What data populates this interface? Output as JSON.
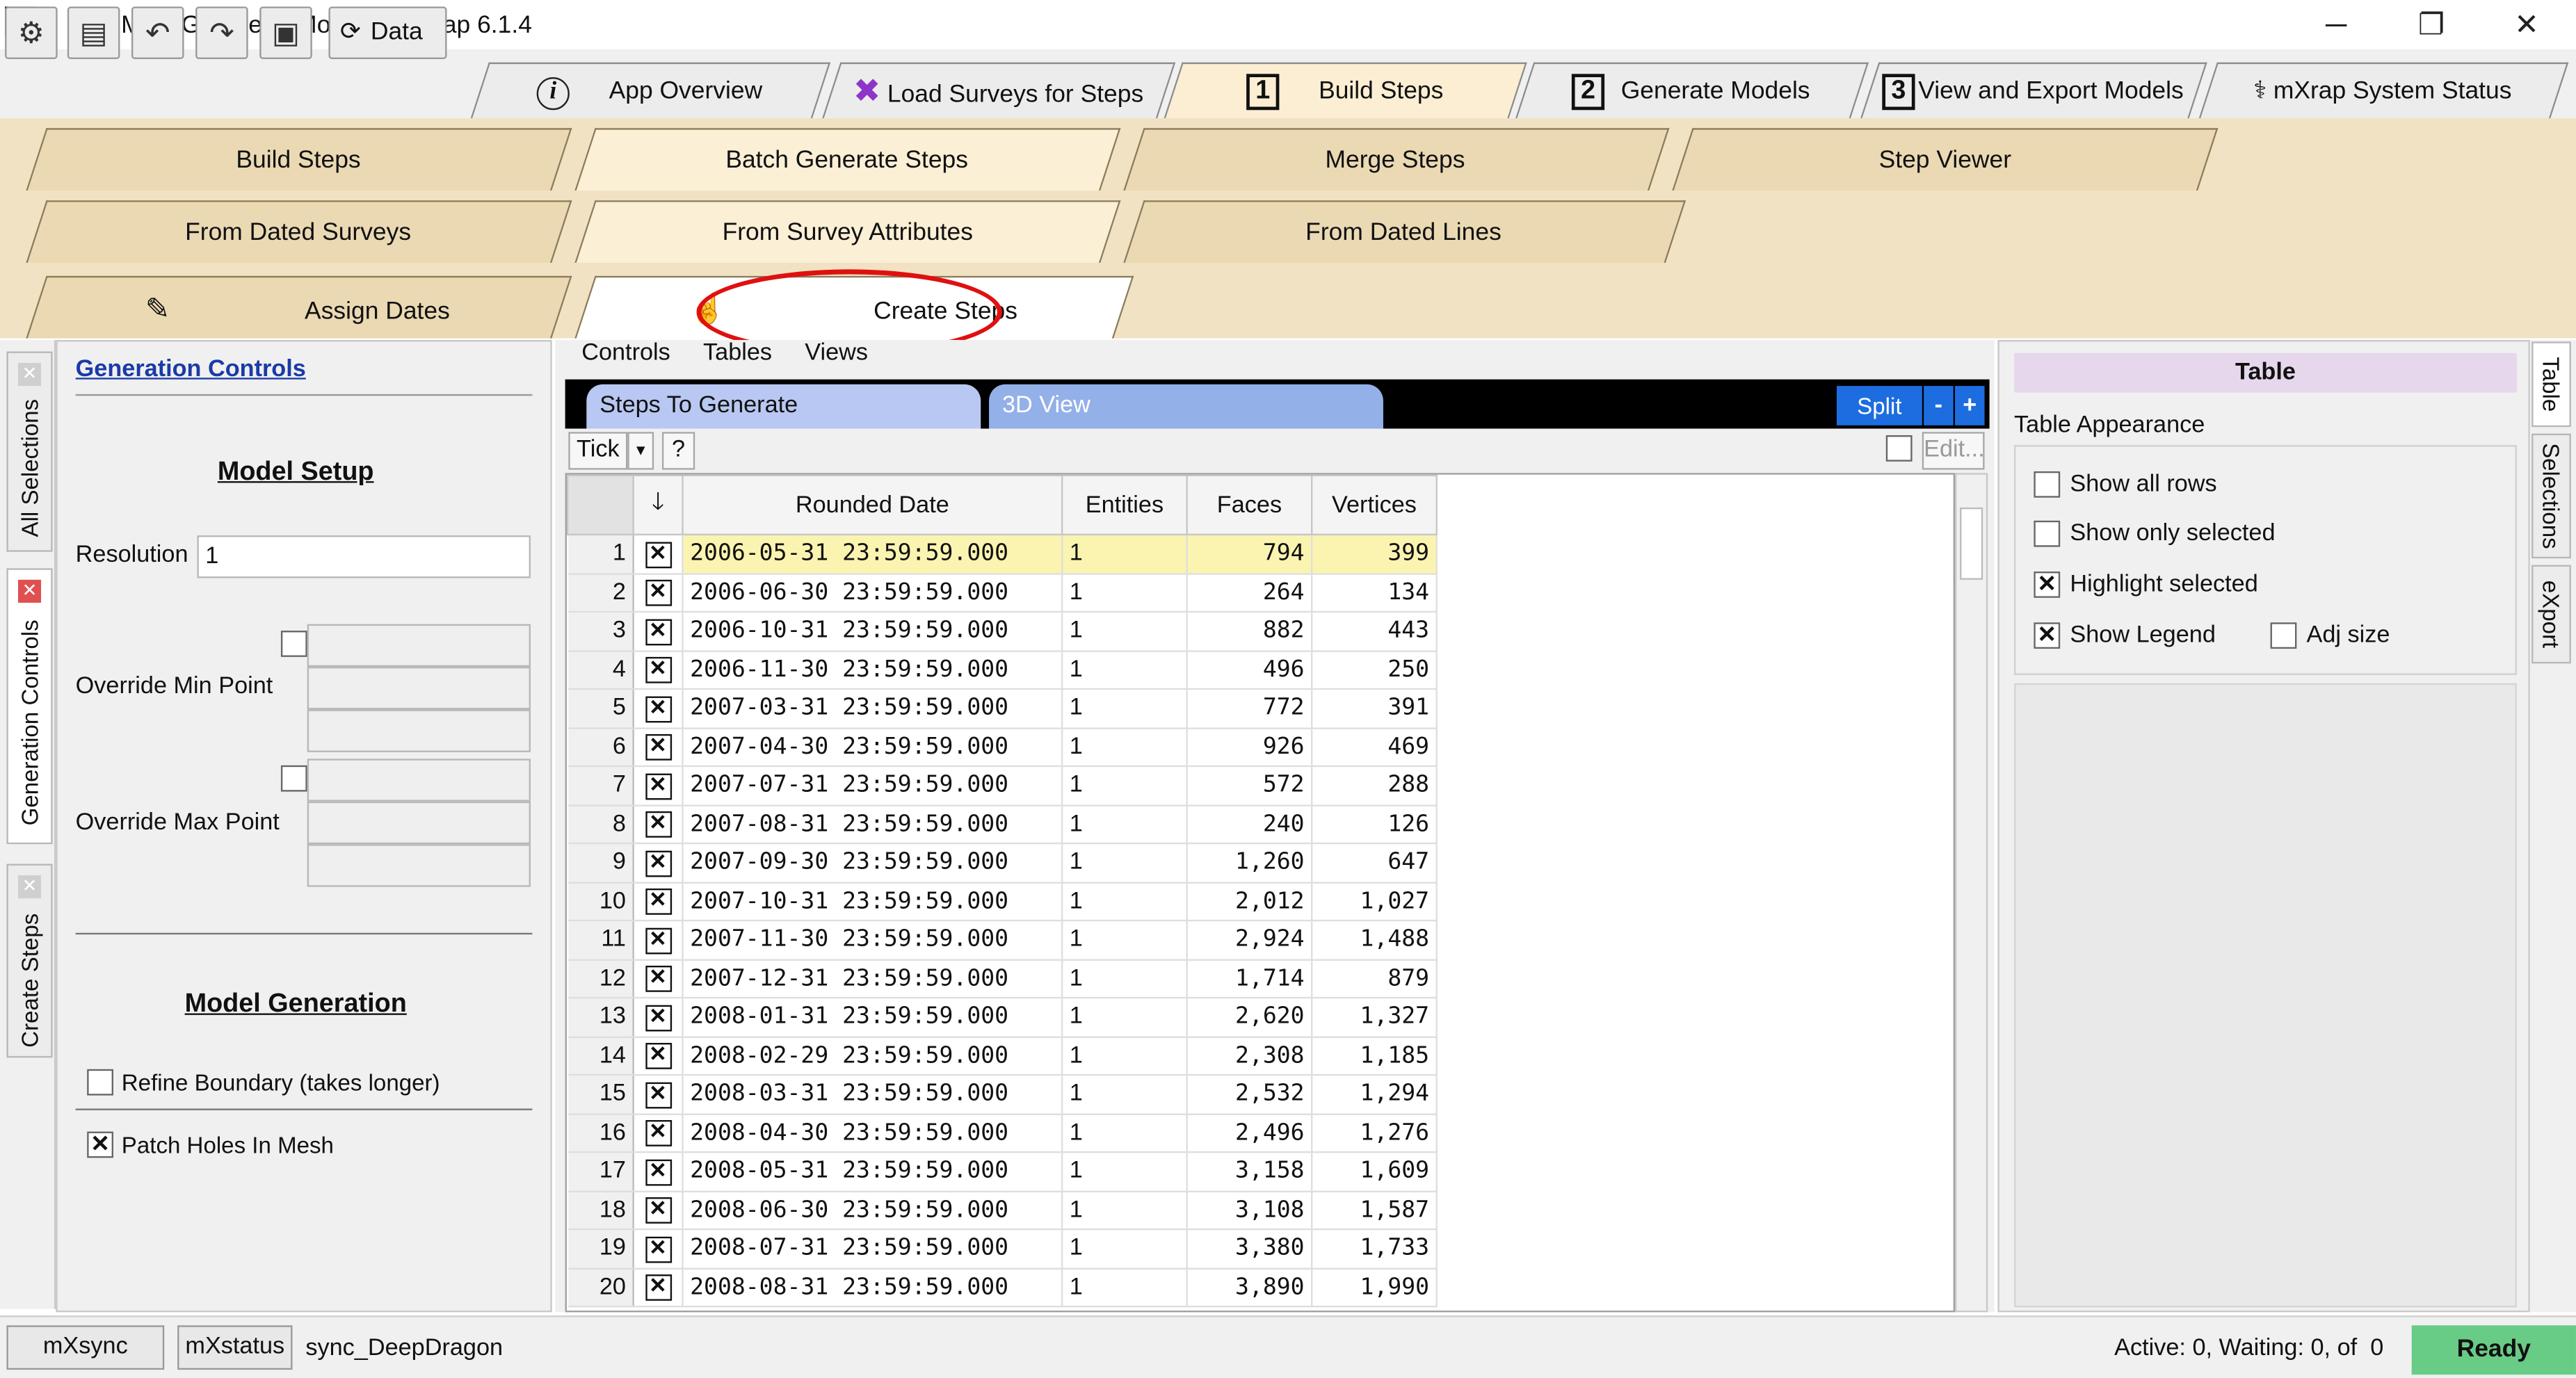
{
  "window": {
    "title": "Mine Geometry Models - mXrap 6.1.4",
    "title_arrow": "▶"
  },
  "toolbar": {
    "data_label": "Data"
  },
  "main_tabs": [
    {
      "label": "App Overview",
      "number": ""
    },
    {
      "label": "Load Surveys for Steps",
      "number": ""
    },
    {
      "label": "Build Steps",
      "number": "1"
    },
    {
      "label": "Generate Models",
      "number": "2"
    },
    {
      "label": "View and Export Models",
      "number": "3"
    },
    {
      "label": "mXrap System Status",
      "number": ""
    }
  ],
  "sub_tabs": [
    "Build Steps",
    "Batch Generate Steps",
    "Merge Steps",
    "Step Viewer"
  ],
  "sub_sub_tabs": [
    "From Dated Surveys",
    "From Survey Attributes",
    "From Dated Lines"
  ],
  "page_tabs": [
    "Assign Dates",
    "Create Steps"
  ],
  "left_vtabs": [
    "All Selections",
    "Generation Controls",
    "Create Steps"
  ],
  "left_panel": {
    "link_header": "Generation Controls",
    "model_setup": "Model Setup",
    "resolution_label": "Resolution",
    "resolution_value": "1",
    "override_min_label": "Override Min Point",
    "override_max_label": "Override Max Point",
    "model_generation": "Model Generation",
    "refine_label": "Refine Boundary (takes longer)",
    "refine_checked": false,
    "patch_label": "Patch Holes In Mesh",
    "patch_checked": true
  },
  "center": {
    "menu": [
      "Controls",
      "Tables",
      "Views"
    ],
    "panel_tabs": [
      "Steps To Generate",
      "3D View"
    ],
    "split_label": "Split",
    "minus_label": "-",
    "plus_label": "+",
    "tick_label": "Tick",
    "help_label": "?",
    "edit_label": "Edit...",
    "columns": [
      "Rounded Date",
      "Entities",
      "Faces",
      "Vertices"
    ],
    "rows": [
      {
        "n": "1",
        "date": "2006-05-31 23:59:59.000",
        "entities": "1",
        "faces": "794",
        "vertices": "399"
      },
      {
        "n": "2",
        "date": "2006-06-30 23:59:59.000",
        "entities": "1",
        "faces": "264",
        "vertices": "134"
      },
      {
        "n": "3",
        "date": "2006-10-31 23:59:59.000",
        "entities": "1",
        "faces": "882",
        "vertices": "443"
      },
      {
        "n": "4",
        "date": "2006-11-30 23:59:59.000",
        "entities": "1",
        "faces": "496",
        "vertices": "250"
      },
      {
        "n": "5",
        "date": "2007-03-31 23:59:59.000",
        "entities": "1",
        "faces": "772",
        "vertices": "391"
      },
      {
        "n": "6",
        "date": "2007-04-30 23:59:59.000",
        "entities": "1",
        "faces": "926",
        "vertices": "469"
      },
      {
        "n": "7",
        "date": "2007-07-31 23:59:59.000",
        "entities": "1",
        "faces": "572",
        "vertices": "288"
      },
      {
        "n": "8",
        "date": "2007-08-31 23:59:59.000",
        "entities": "1",
        "faces": "240",
        "vertices": "126"
      },
      {
        "n": "9",
        "date": "2007-09-30 23:59:59.000",
        "entities": "1",
        "faces": "1,260",
        "vertices": "647"
      },
      {
        "n": "10",
        "date": "2007-10-31 23:59:59.000",
        "entities": "1",
        "faces": "2,012",
        "vertices": "1,027"
      },
      {
        "n": "11",
        "date": "2007-11-30 23:59:59.000",
        "entities": "1",
        "faces": "2,924",
        "vertices": "1,488"
      },
      {
        "n": "12",
        "date": "2007-12-31 23:59:59.000",
        "entities": "1",
        "faces": "1,714",
        "vertices": "879"
      },
      {
        "n": "13",
        "date": "2008-01-31 23:59:59.000",
        "entities": "1",
        "faces": "2,620",
        "vertices": "1,327"
      },
      {
        "n": "14",
        "date": "2008-02-29 23:59:59.000",
        "entities": "1",
        "faces": "2,308",
        "vertices": "1,185"
      },
      {
        "n": "15",
        "date": "2008-03-31 23:59:59.000",
        "entities": "1",
        "faces": "2,532",
        "vertices": "1,294"
      },
      {
        "n": "16",
        "date": "2008-04-30 23:59:59.000",
        "entities": "1",
        "faces": "2,496",
        "vertices": "1,276"
      },
      {
        "n": "17",
        "date": "2008-05-31 23:59:59.000",
        "entities": "1",
        "faces": "3,158",
        "vertices": "1,609"
      },
      {
        "n": "18",
        "date": "2008-06-30 23:59:59.000",
        "entities": "1",
        "faces": "3,108",
        "vertices": "1,587"
      },
      {
        "n": "19",
        "date": "2008-07-31 23:59:59.000",
        "entities": "1",
        "faces": "3,380",
        "vertices": "1,733"
      },
      {
        "n": "20",
        "date": "2008-08-31 23:59:59.000",
        "entities": "1",
        "faces": "3,890",
        "vertices": "1,990"
      }
    ]
  },
  "right_panel": {
    "header": "Table",
    "appearance_label": "Table Appearance",
    "show_all_rows": "Show all rows",
    "show_only_selected": "Show only selected",
    "highlight_selected": "Highlight selected",
    "show_legend": "Show Legend",
    "adj_size": "Adj size"
  },
  "right_vtabs": [
    "Table",
    "Selections",
    "eXport"
  ],
  "statusbar": {
    "mxsync": "mXsync",
    "mxstatus": "mXstatus",
    "sync_name": "sync_DeepDragon",
    "activity": "Active: 0, Waiting: 0, of  0",
    "ready": "Ready"
  },
  "colors": {
    "accent": "#1d6de0",
    "ready_green": "#69cc86",
    "highlight_row": "#fbf4b0",
    "annotation_red": "#e01010"
  }
}
